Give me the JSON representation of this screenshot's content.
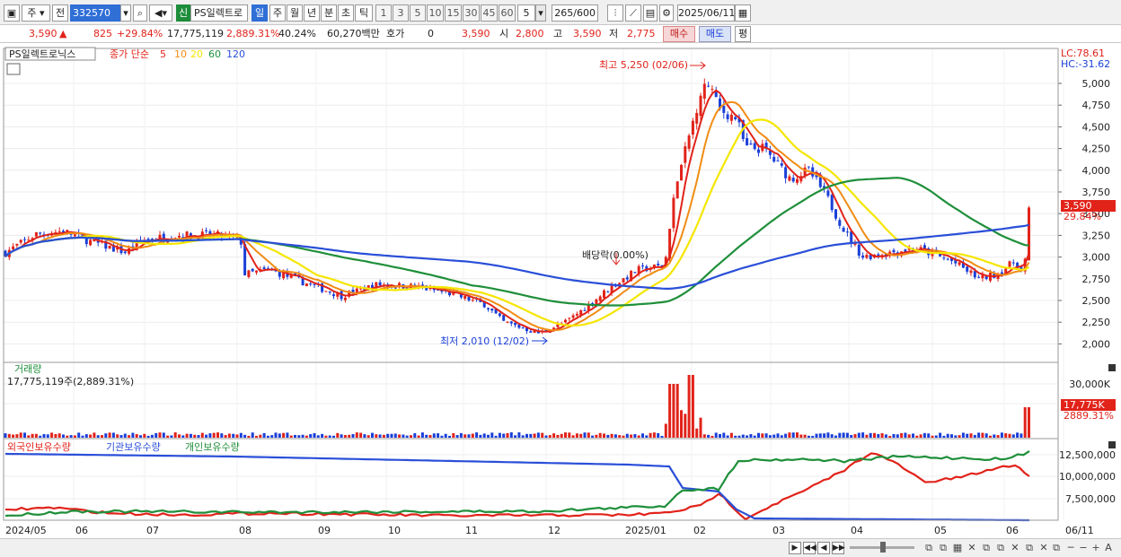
{
  "toolbar": {
    "market": "주",
    "prefix": "전",
    "code": "332570",
    "news_badge": "신",
    "stock_name": "PS일렉트로",
    "periods": [
      "일",
      "주",
      "월",
      "년",
      "분",
      "초",
      "틱"
    ],
    "active_period": "일",
    "intervals": [
      "1",
      "3",
      "5",
      "10",
      "15",
      "30",
      "45",
      "60"
    ],
    "interval_value": "5",
    "count": "265",
    "count_total": "/600",
    "date": "2025/06/11"
  },
  "quote": {
    "price": "3,590",
    "arrow": "▲",
    "change": "825",
    "change_pct": "+29.84%",
    "volume": "17,775,119",
    "volume_ratio": "2,889.31%",
    "turnover": "40.24%",
    "amount": "60,270백만",
    "hoga_label": "호가",
    "hoga_value": "0",
    "hoga_price": "3,590",
    "open_label": "시",
    "open": "2,800",
    "high_label": "고",
    "high": "3,590",
    "low_label": "저",
    "low": "2,775",
    "buy_btn": "매수",
    "sell_btn": "매도",
    "eval_btn": "평"
  },
  "price_panel": {
    "legend_name": "PS일렉트로닉스",
    "legend_ma_prefix": "종가 단순",
    "ma_periods": [
      "5",
      "10",
      "20",
      "60",
      "120"
    ],
    "ma_colors": [
      "#e1231a",
      "#f08c14",
      "#f5e600",
      "#1f8f3a",
      "#2a4fd8"
    ],
    "lc": "LC:78.61",
    "hc": "HC:-31.62",
    "y_ticks": [
      "5,000",
      "4,750",
      "4,500",
      "4,250",
      "4,000",
      "3,750",
      "3,500",
      "3,250",
      "3,000",
      "2,750",
      "2,500",
      "2,250",
      "2,000"
    ],
    "current_price_tag": "3,590",
    "current_pct_tag": "29.84%",
    "annot_high": "최고 5,250 (02/06)",
    "annot_low": "최저 2,010 (12/02)",
    "annot_dividend": "배당락(0.00%)"
  },
  "volume_panel": {
    "title": "거래량",
    "value": "17,775,119주(2,889.31%)",
    "y_ticks": [
      "30,000K",
      "20,000K"
    ],
    "tag_value": "17,775K",
    "tag_pct": "2889.31%"
  },
  "holding_panel": {
    "series_labels": [
      "외국인보유수량",
      "기관보유수량",
      "개인보유수량"
    ],
    "series_colors": [
      "#e1231a",
      "#2a4fd8",
      "#1f8f3a"
    ],
    "y_ticks": [
      "12,500,000",
      "10,000,000",
      "7,500,000"
    ]
  },
  "x_axis": {
    "labels": [
      "2024/05",
      "06",
      "07",
      "08",
      "09",
      "10",
      "11",
      "12",
      "2025/01",
      "02",
      "03",
      "04",
      "05",
      "06",
      "06/11"
    ]
  },
  "colors": {
    "up": "#e1231a",
    "down": "#1a3fd8",
    "accent": "#2f6fd6"
  }
}
